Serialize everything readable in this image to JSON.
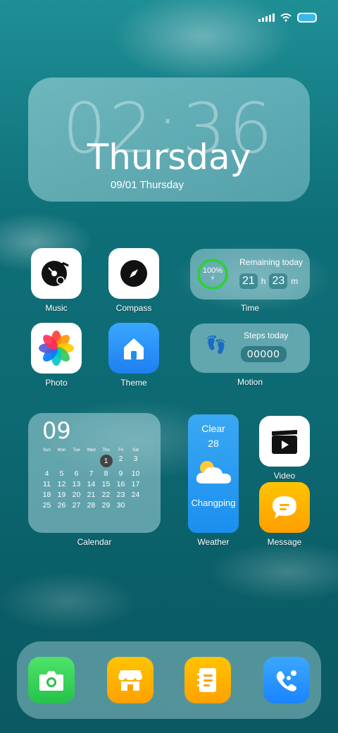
{
  "status_bar": {
    "icons": [
      "signal-icon",
      "wifi-icon",
      "battery-icon"
    ]
  },
  "clock": {
    "time": "02:36",
    "weekday": "Thursday",
    "date": "09/01 Thursday"
  },
  "apps": {
    "music": "Music",
    "compass": "Compass",
    "photo": "Photo",
    "theme": "Theme",
    "video": "Video",
    "message": "Message"
  },
  "time_widget": {
    "battery": "100%",
    "title": "Remaining today",
    "hours": "21",
    "hours_unit": "h",
    "minutes": "23",
    "minutes_unit": "m",
    "label": "Time"
  },
  "motion_widget": {
    "title": "Steps today",
    "steps": "00000",
    "label": "Motion"
  },
  "calendar_widget": {
    "month": "09",
    "weekdays": [
      "Sun",
      "Mon",
      "Tue",
      "Wed",
      "Thu",
      "Fri",
      "Sat"
    ],
    "today": "1",
    "label": "Calendar"
  },
  "weather_widget": {
    "condition": "Clear",
    "temp": "28",
    "location": "Changping",
    "label": "Weather"
  },
  "dock": {
    "apps": [
      "camera-icon",
      "store-icon",
      "notes-icon",
      "phone-icon"
    ]
  },
  "colors": {
    "green": "#2ed03a",
    "theme_blue": "#1e8ff0",
    "message_orange": "#ffae00",
    "phone_blue": "#1a8cff"
  }
}
